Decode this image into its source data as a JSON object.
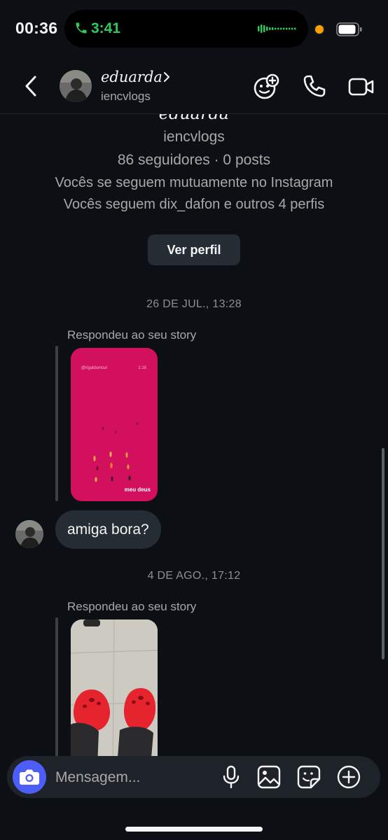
{
  "status_bar": {
    "time": "00:36",
    "call_timer": "3:41",
    "icons": [
      "phone-call-icon",
      "audio-waveform-icon",
      "camera-in-use-dot",
      "battery-icon"
    ]
  },
  "header": {
    "display_name": "eduarda",
    "username": "iencvlogs",
    "icons": [
      "back-chevron-icon",
      "chevron-right-icon",
      "sticker-effects-icon",
      "phone-icon",
      "video-camera-icon"
    ]
  },
  "profile": {
    "display_name": "eduarda",
    "username": "iencvlogs",
    "stats": "86 seguidores · 0 posts",
    "mutual_text": "Vocês se seguem mutuamente no Instagram",
    "follows_text": "Vocês seguem dix_dafon e outros 4 perfis",
    "view_profile_label": "Ver perfil"
  },
  "thread": {
    "timestamp_1": "26 DE JUL., 13:28",
    "story_reply_1": {
      "caption": "Respondeu ao seu story",
      "story_top_left": "@rigaldumcul",
      "story_top_right": "1:16",
      "story_bottom_label": "meu deus"
    },
    "message_1": "amiga bora?",
    "timestamp_2": "4 DE AGO., 17:12",
    "story_reply_2": {
      "caption": "Respondeu ao seu story"
    }
  },
  "composer": {
    "placeholder": "Mensagem...",
    "icons": [
      "camera-icon",
      "microphone-icon",
      "gallery-icon",
      "sticker-icon",
      "plus-circle-icon"
    ]
  },
  "colors": {
    "background": "#0c1014",
    "bubble": "#262c33",
    "accent_blue": "#4d5ef6",
    "call_green": "#34c759",
    "story_pink": "#d2105d",
    "crocs_red": "#e5242d"
  }
}
